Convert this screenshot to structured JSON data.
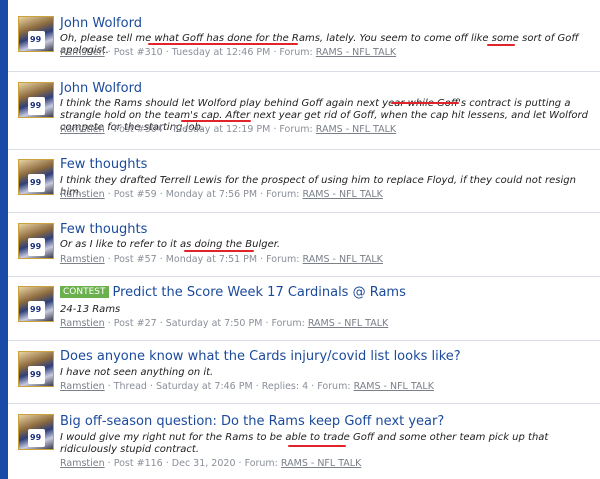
{
  "results": [
    {
      "title": "John Wolford",
      "badge": "",
      "snippet": "Oh, please tell me what Goff has done for the Rams, lately. You seem to come off like some sort of Goff apologist.",
      "user": "Ramstien",
      "type": "Post #310",
      "date": "Tuesday at 12:46 PM",
      "forum_prefix": "Forum:",
      "forum": "RAMS - NFL TALK"
    },
    {
      "title": "John Wolford",
      "badge": "",
      "snippet": "I think the Rams should let Wolford play behind Goff again next year while Goff's contract is putting a strangle hold on the team's cap. After next year get rid of Goff, when the cap hit lessens, and let Wolford compete for the starting job.",
      "user": "Ramstien",
      "type": "Post #304",
      "date": "Tuesday at 12:19 PM",
      "forum_prefix": "Forum:",
      "forum": "RAMS - NFL TALK"
    },
    {
      "title": "Few thoughts",
      "badge": "",
      "snippet": "I think they drafted Terrell Lewis for the prospect of using him to replace Floyd, if they could not resign him.",
      "user": "Ramstien",
      "type": "Post #59",
      "date": "Monday at 7:56 PM",
      "forum_prefix": "Forum:",
      "forum": "RAMS - NFL TALK"
    },
    {
      "title": "Few thoughts",
      "badge": "",
      "snippet": "Or as I like to refer to it as doing the Bulger.",
      "user": "Ramstien",
      "type": "Post #57",
      "date": "Monday at 7:51 PM",
      "forum_prefix": "Forum:",
      "forum": "RAMS - NFL TALK"
    },
    {
      "title": "Predict the Score Week 17 Cardinals @ Rams",
      "badge": "CONTEST",
      "snippet": "24-13 Rams",
      "user": "Ramstien",
      "type": "Post #27",
      "date": "Saturday at 7:50 PM",
      "forum_prefix": "Forum:",
      "forum": "RAMS - NFL TALK"
    },
    {
      "title": "Does anyone know what the Cards injury/covid list looks like?",
      "badge": "",
      "snippet": "I have not seen anything on it.",
      "user": "Ramstien",
      "type": "Thread",
      "date": "Saturday at 7:46 PM",
      "replies": "Replies: 4",
      "forum_prefix": "Forum:",
      "forum": "RAMS - NFL TALK"
    },
    {
      "title": "Big off-season question: Do the Rams keep Goff next year?",
      "badge": "",
      "snippet": "I would give my right nut for the Rams to be able to trade Goff and some other team pick up that ridiculously stupid contract.",
      "user": "Ramstien",
      "type": "Post #116",
      "date": "Dec 31, 2020",
      "forum_prefix": "Forum:",
      "forum": "RAMS - NFL TALK"
    }
  ],
  "avatar_number": "99",
  "colors": {
    "accent": "#1b4a9c",
    "sidebar": "#1a4aa8",
    "badge": "#6ab04c",
    "ink": "#e0242a"
  }
}
